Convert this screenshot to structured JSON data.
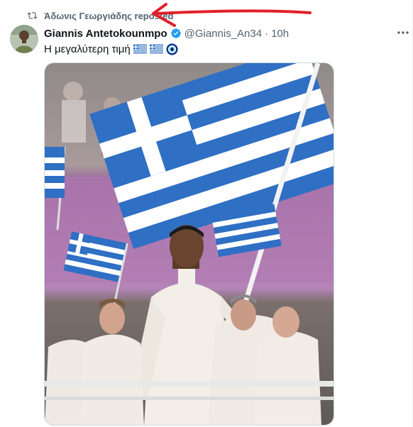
{
  "repost": {
    "text": "Άδωνις Γεωργιάδης reposted",
    "icon": "repost-icon"
  },
  "tweet": {
    "display_name": "Giannis Antetokounmpo",
    "handle": "@Giannis_An34",
    "separator": "·",
    "time": "10h",
    "text": "Η μεγαλύτερη τιμή",
    "emojis": [
      "greece-flag-emoji",
      "greece-flag-emoji",
      "nazar-amulet-emoji"
    ],
    "verified_icon": "verified-badge-icon",
    "more_icon": "more-options-icon"
  },
  "colors": {
    "accent": "#1d9bf0",
    "secondary_text": "#536471",
    "annotation": "#e0202a",
    "flag_blue": "#2f6fc4"
  }
}
